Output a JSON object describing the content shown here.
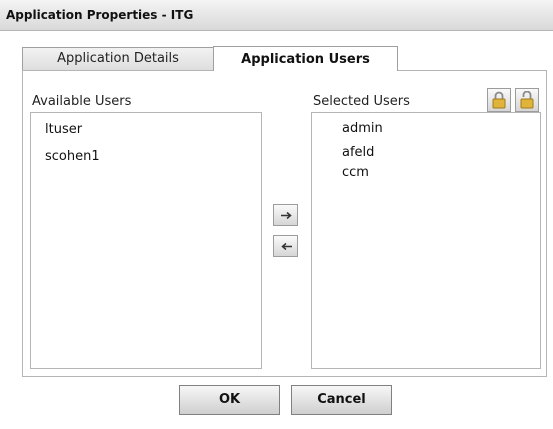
{
  "window": {
    "title": "Application Properties - ITG"
  },
  "tabs": [
    {
      "label": "Application Details"
    },
    {
      "label": "Application Users"
    }
  ],
  "available": {
    "label": "Available Users",
    "items": [
      "ltuser",
      "scohen1"
    ]
  },
  "selected": {
    "label": "Selected Users",
    "items": [
      "admin",
      "afeld",
      "ccm"
    ]
  },
  "icons": {
    "move_right": "arrow-right-icon",
    "move_left": "arrow-left-icon",
    "lock": "lock-closed-icon",
    "unlock": "lock-open-icon"
  },
  "buttons": {
    "ok": "OK",
    "cancel": "Cancel"
  }
}
